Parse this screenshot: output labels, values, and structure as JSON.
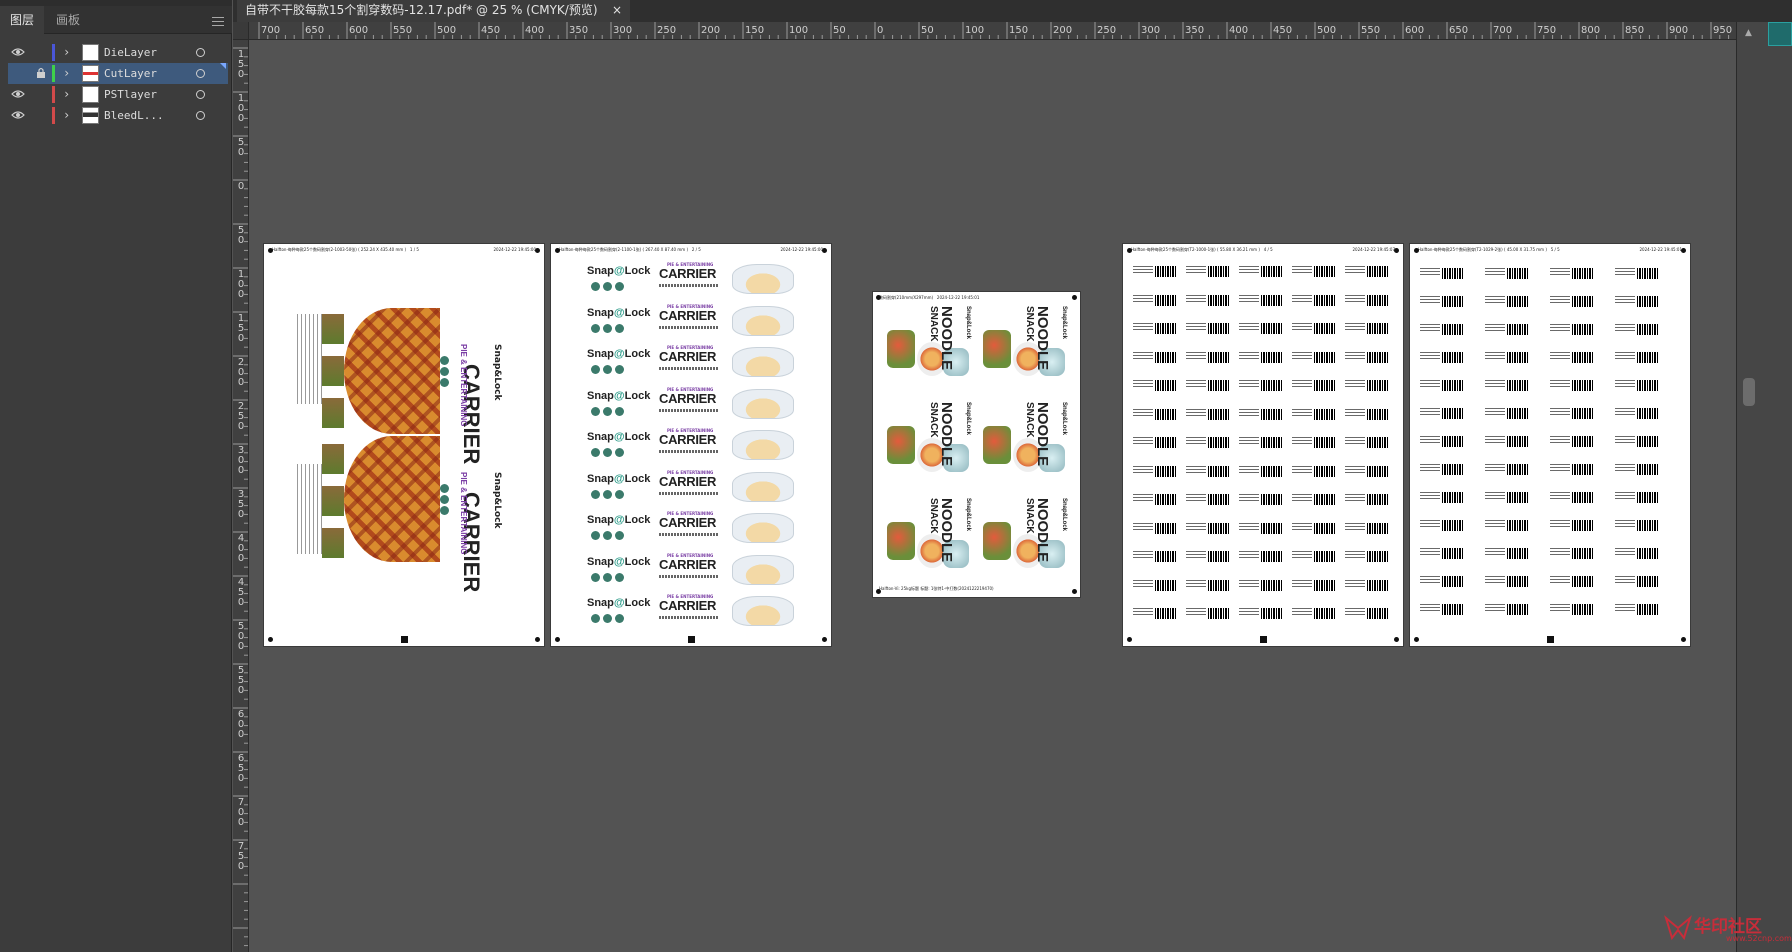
{
  "panel": {
    "tabs": [
      {
        "label": "图层",
        "active": true
      },
      {
        "label": "画板",
        "active": false
      }
    ],
    "layers": [
      {
        "name": "DieLayer",
        "visible": true,
        "locked": false,
        "color": "#4a56d8",
        "selected": false
      },
      {
        "name": "CutLayer",
        "visible": false,
        "locked": true,
        "color": "#3ed04a",
        "selected": true
      },
      {
        "name": "PSTlayer",
        "visible": true,
        "locked": false,
        "color": "#d24a4a",
        "selected": false
      },
      {
        "name": "BleedL...",
        "visible": true,
        "locked": false,
        "color": "#d24a4a",
        "selected": false
      }
    ]
  },
  "document": {
    "tab_title": "自带不干胶每款15个割穿数码-12.17.pdf* @ 25 % (CMYK/预览)",
    "close_label": "×"
  },
  "ruler": {
    "top_labels": [
      "700",
      "650",
      "600",
      "550",
      "500",
      "450",
      "400",
      "350",
      "300",
      "250",
      "200",
      "150",
      "100",
      "50",
      "0",
      "50",
      "100",
      "150",
      "200",
      "250",
      "300",
      "350",
      "400",
      "450",
      "500",
      "550",
      "600",
      "650",
      "700",
      "750",
      "800",
      "850",
      "900",
      "950"
    ],
    "left_labels": [
      "150",
      "100",
      "50",
      "0",
      "50",
      "100",
      "150",
      "200",
      "250",
      "300",
      "350",
      "400",
      "450",
      "500",
      "550",
      "600",
      "650",
      "700",
      "750"
    ]
  },
  "artboards": {
    "board1": {
      "header_left": "Halfton-每种每款25个数码割穿(2-1003-50张) ( 252.24 X 435.40 mm )",
      "header_page": "1 / 5",
      "header_date": "2024-12-22 19:45:00",
      "brand": "Snap&Lock",
      "title": "CARRIER",
      "subtitle": "PIE & ENTERTAINING"
    },
    "board2": {
      "header_left": "Halfton-每种每款25个数码割穿(2-1100-1张) ( 267.40 X 87.40 mm )",
      "header_page": "2 / 5",
      "header_date": "2024-12-22 19:45:00",
      "brand_left": "Snap",
      "brand_o": "@",
      "brand_right": "Lock",
      "title": "CARRIER",
      "subtitle": "PIE & ENTERTAINING",
      "rows": 9
    },
    "board3": {
      "header_left": "数码割穿(210mm/X297mm)",
      "header_date": "2024-12-22 19:45:01",
      "footer": "Halfton-Vi: 25kg标题 标题: 1张特1-中打数(2024122219470)",
      "brand": "Snap&Lock",
      "title": "NOODLE",
      "title2": "SNACK"
    },
    "board4": {
      "header_left": "Halfton-每种每款25个数码割穿(T2-1000-1张) ( 55.80 X 36.21 mm )",
      "header_page": "4 / 5",
      "header_date": "2024-12-22 19:45:07"
    },
    "board5": {
      "header_left": "Halfton-每种每款25个数码割穿(T2-1029-2张) ( 45.00 X 31.75 mm )",
      "header_page": "5 / 5",
      "header_date": "2024-12-22 19:45:01"
    }
  },
  "watermark": {
    "text": "华印社区",
    "url": "www.52cnp.com"
  }
}
